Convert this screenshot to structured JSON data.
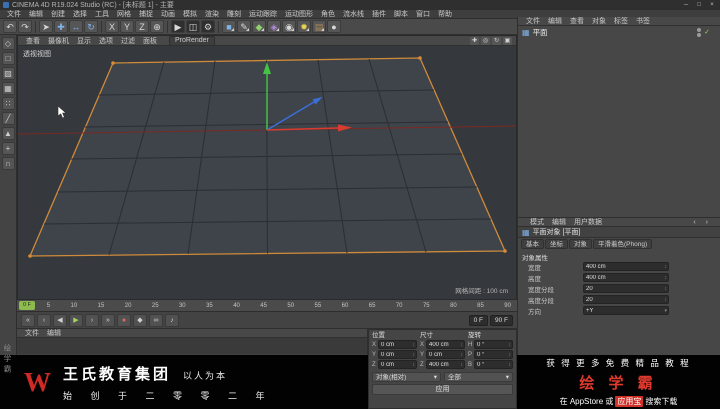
{
  "window": {
    "title": "CINEMA 4D R19.024 Studio (RC) - [未标题 1] - 主要",
    "min": "─",
    "max": "□",
    "close": "×"
  },
  "menu": {
    "items": [
      "文件",
      "编辑",
      "创建",
      "选择",
      "工具",
      "网格",
      "捕捉",
      "动画",
      "模拟",
      "渲染",
      "雕刻",
      "运动跟踪",
      "运动图形",
      "角色",
      "流水线",
      "插件",
      "脚本",
      "窗口",
      "帮助"
    ]
  },
  "toolbar": {
    "icons": [
      {
        "name": "undo-icon",
        "glyph": "↶"
      },
      {
        "name": "redo-icon",
        "glyph": "↷"
      },
      {
        "name": "live-selection-icon",
        "glyph": "➤"
      },
      {
        "name": "move-tool-icon",
        "glyph": "✚"
      },
      {
        "name": "scale-tool-icon",
        "glyph": "↔"
      },
      {
        "name": "rotate-tool-icon",
        "glyph": "↻"
      },
      {
        "name": "x-axis-button",
        "glyph": "X"
      },
      {
        "name": "y-axis-button",
        "glyph": "Y"
      },
      {
        "name": "z-axis-button",
        "glyph": "Z"
      },
      {
        "name": "coordinate-system-icon",
        "glyph": "⊕"
      },
      {
        "name": "render-view-icon",
        "glyph": "▶"
      },
      {
        "name": "render-picture-icon",
        "glyph": "◫"
      },
      {
        "name": "render-settings-icon",
        "glyph": "⚙"
      },
      {
        "name": "cube-primitive-icon",
        "glyph": "■"
      },
      {
        "name": "spline-pen-icon",
        "glyph": "✎"
      },
      {
        "name": "generator-icon",
        "glyph": "◆"
      },
      {
        "name": "deformer-icon",
        "glyph": "◈"
      },
      {
        "name": "camera-icon",
        "glyph": "◉"
      },
      {
        "name": "light-icon",
        "glyph": "✹"
      },
      {
        "name": "environment-icon",
        "glyph": "▤"
      },
      {
        "name": "material-icon",
        "glyph": "●"
      }
    ]
  },
  "sidebar": {
    "icons": [
      {
        "name": "make-editable-icon",
        "glyph": "◇"
      },
      {
        "name": "model-mode-icon",
        "glyph": "□"
      },
      {
        "name": "texture-mode-icon",
        "glyph": "▨"
      },
      {
        "name": "workplane-mode-icon",
        "glyph": "▦"
      },
      {
        "name": "points-mode-icon",
        "glyph": "∷"
      },
      {
        "name": "edges-mode-icon",
        "glyph": "╱"
      },
      {
        "name": "polygons-mode-icon",
        "glyph": "▲"
      },
      {
        "name": "axis-mode-icon",
        "glyph": "+"
      },
      {
        "name": "snap-icon",
        "glyph": "∩"
      }
    ]
  },
  "viewport": {
    "menu_items": [
      "查看",
      "摄像机",
      "显示",
      "选项",
      "过滤",
      "面板"
    ],
    "renderer_tab": "ProRender",
    "nav_icons": [
      {
        "name": "pan-view-icon",
        "glyph": "✚"
      },
      {
        "name": "zoom-view-icon",
        "glyph": "◎"
      },
      {
        "name": "rotate-view-icon",
        "glyph": "↻"
      },
      {
        "name": "maximize-view-icon",
        "glyph": "▣"
      }
    ],
    "view_label": "透视视图",
    "grid_hint": "网格间距 : 100 cm"
  },
  "timeline": {
    "ticks": [
      "0",
      "5",
      "10",
      "15",
      "20",
      "25",
      "30",
      "35",
      "40",
      "45",
      "50",
      "55",
      "60",
      "65",
      "70",
      "75",
      "80",
      "85",
      "90"
    ],
    "marker": "0 F"
  },
  "transport": {
    "icons": [
      {
        "name": "goto-start-button",
        "glyph": "«"
      },
      {
        "name": "prev-key-button",
        "glyph": "‹"
      },
      {
        "name": "prev-frame-button",
        "glyph": "◀"
      },
      {
        "name": "play-button",
        "glyph": "▶"
      },
      {
        "name": "next-frame-button",
        "glyph": "›"
      },
      {
        "name": "goto-end-button",
        "glyph": "»"
      },
      {
        "name": "record-button",
        "glyph": "●"
      },
      {
        "name": "keyframe-button",
        "glyph": "◆"
      },
      {
        "name": "loop-button",
        "glyph": "∞"
      },
      {
        "name": "sound-button",
        "glyph": "♪"
      }
    ],
    "start_field": "0 F",
    "end_field": "90 F"
  },
  "materials": {
    "menu_items": [
      "文件",
      "编辑"
    ]
  },
  "coords": {
    "groups": [
      {
        "title": "位置",
        "rows": [
          {
            "axis": "X",
            "value": "0 cm"
          },
          {
            "axis": "Y",
            "value": "0 cm"
          },
          {
            "axis": "Z",
            "value": "0 cm"
          }
        ]
      },
      {
        "title": "尺寸",
        "rows": [
          {
            "axis": "X",
            "value": "400 cm"
          },
          {
            "axis": "Y",
            "value": "0 cm"
          },
          {
            "axis": "Z",
            "value": "400 cm"
          }
        ]
      },
      {
        "title": "旋转",
        "rows": [
          {
            "axis": "H",
            "value": "0 °"
          },
          {
            "axis": "P",
            "value": "0 °"
          },
          {
            "axis": "B",
            "value": "0 °"
          }
        ]
      }
    ],
    "mode": "对象(相对)",
    "scope": "全部",
    "apply": "应用"
  },
  "object_manager": {
    "menu_items": [
      "文件",
      "编辑",
      "查看",
      "对象",
      "标签",
      "书签"
    ],
    "objects": [
      {
        "name": "平面"
      }
    ]
  },
  "attributes": {
    "menu_items": [
      "模式",
      "编辑",
      "用户数据"
    ],
    "title": "平面对象 [平面]",
    "tabs": [
      "基本",
      "坐标",
      "对象",
      "平滑着色(Phong)"
    ],
    "section": "对象属性",
    "rows": [
      {
        "label": "宽度",
        "value": "400 cm",
        "ctrl": "↕"
      },
      {
        "label": "高度",
        "value": "400 cm",
        "ctrl": "↕"
      },
      {
        "label": "宽度分段",
        "value": "20",
        "ctrl": "↕"
      },
      {
        "label": "高度分段",
        "value": "20",
        "ctrl": "↕"
      },
      {
        "label": "方向",
        "value": "+Y",
        "ctrl": "▾"
      }
    ]
  },
  "branding": {
    "logo": "W",
    "company": "王氏教育集团",
    "slogan": "以人为本",
    "founded": "始 创 于 二 零 零 二 年"
  },
  "ad": {
    "line1": "获 得 更 多 免 费 精 品 教 程",
    "brand": "绘 学 霸",
    "line2_prefix": "在 AppStore 或",
    "line2_highlight": "应用宝",
    "line2_suffix": "搜索下载"
  },
  "watermark": {
    "vertical": "绘学霸"
  }
}
